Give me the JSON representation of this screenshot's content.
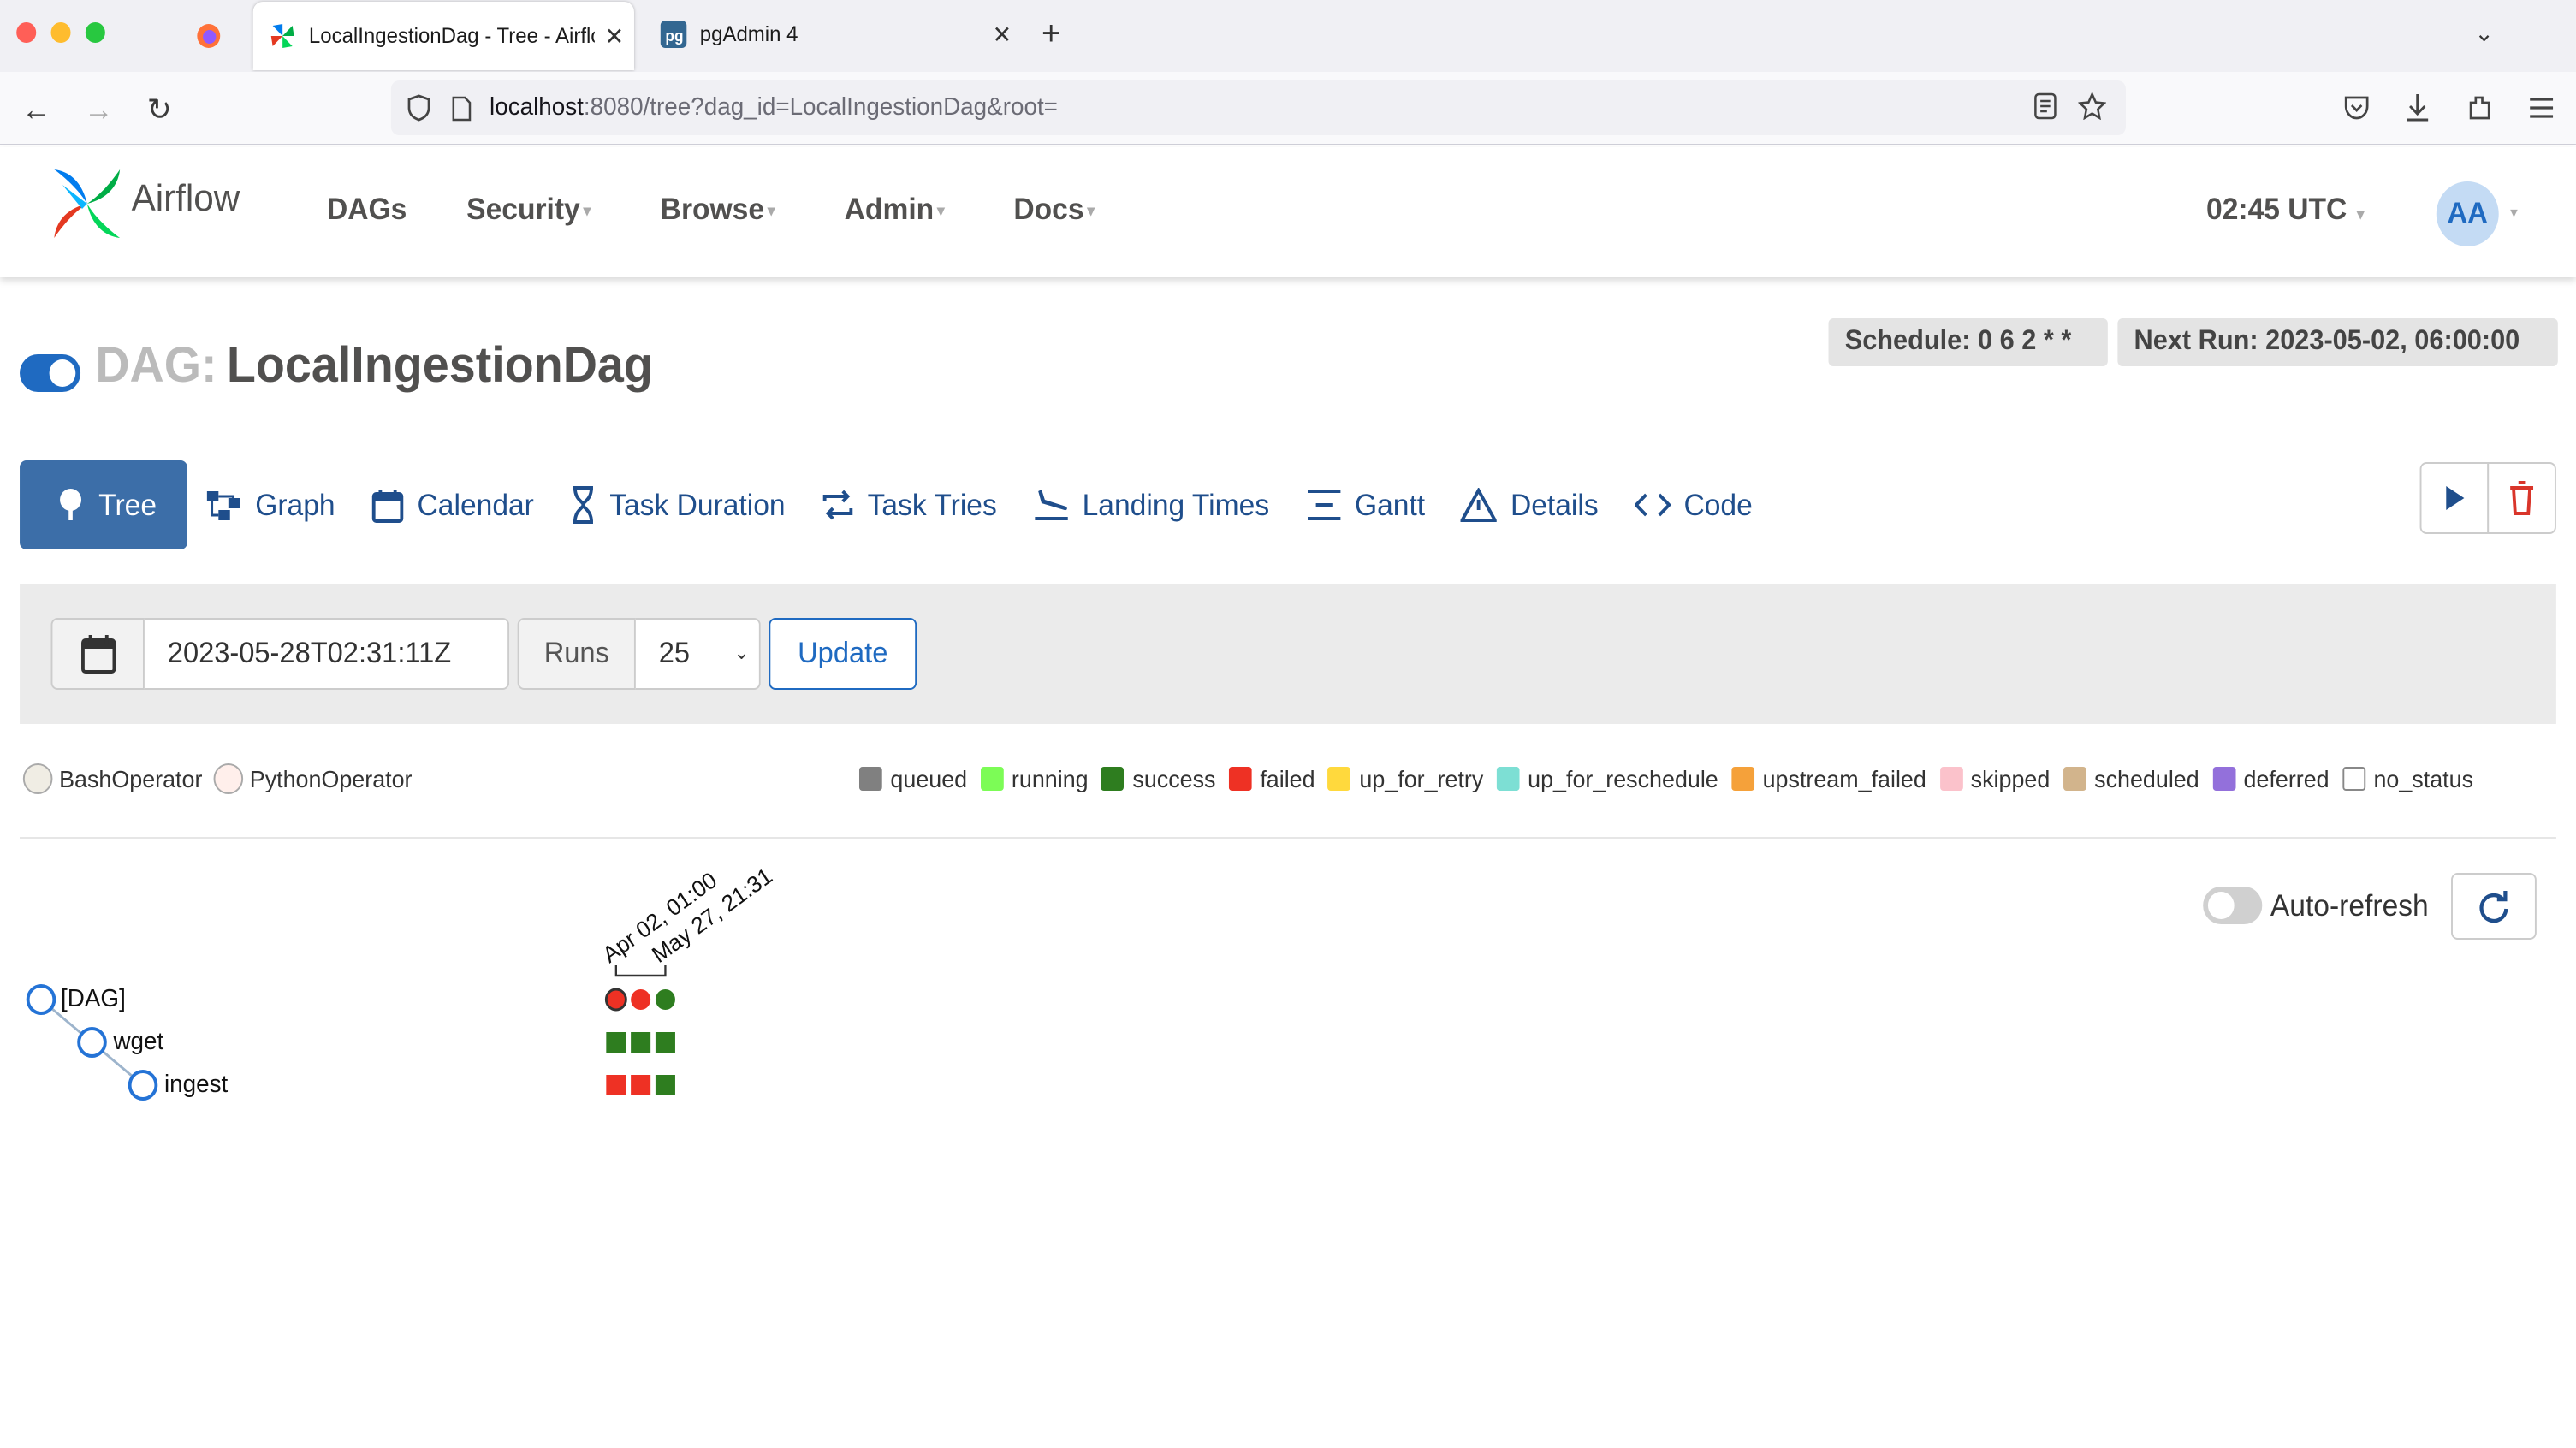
{
  "browser": {
    "tabs": [
      {
        "title": "LocalIngestionDag - Tree - Airflow",
        "active": true,
        "icon": "airflow-pinwheel-icon"
      },
      {
        "title": "pgAdmin 4",
        "active": false,
        "icon": "pgadmin-icon"
      }
    ],
    "url": {
      "host": "localhost",
      "rest": ":8080/tree?dag_id=LocalIngestionDag&root="
    }
  },
  "header": {
    "brand": "Airflow",
    "menu": [
      {
        "label": "DAGs",
        "dropdown": false
      },
      {
        "label": "Security",
        "dropdown": true
      },
      {
        "label": "Browse",
        "dropdown": true
      },
      {
        "label": "Admin",
        "dropdown": true
      },
      {
        "label": "Docs",
        "dropdown": true
      }
    ],
    "clock": "02:45 UTC",
    "avatar": "AA"
  },
  "dag": {
    "prefix": "DAG:",
    "name": "LocalIngestionDag",
    "schedule": "Schedule: 0 6 2 * *",
    "next_run": "Next Run: 2023-05-02, 06:00:00",
    "paused": false
  },
  "views": [
    {
      "label": "Tree",
      "icon": "tree-icon",
      "active": true
    },
    {
      "label": "Graph",
      "icon": "graph-icon"
    },
    {
      "label": "Calendar",
      "icon": "calendar-icon"
    },
    {
      "label": "Task Duration",
      "icon": "hourglass-icon"
    },
    {
      "label": "Task Tries",
      "icon": "retry-icon"
    },
    {
      "label": "Landing Times",
      "icon": "plane-landing-icon"
    },
    {
      "label": "Gantt",
      "icon": "gantt-icon"
    },
    {
      "label": "Details",
      "icon": "warning-triangle-icon"
    },
    {
      "label": "Code",
      "icon": "code-icon"
    }
  ],
  "filter": {
    "base_date": "2023-05-28T02:31:11Z",
    "runs_label": "Runs",
    "runs_value": "25",
    "update_label": "Update"
  },
  "operators": [
    {
      "name": "BashOperator",
      "color": "#f0ede4"
    },
    {
      "name": "PythonOperator",
      "color": "#ffefeb"
    }
  ],
  "states": [
    {
      "name": "queued",
      "color": "#808080"
    },
    {
      "name": "running",
      "color": "#7cfc56"
    },
    {
      "name": "success",
      "color": "#2e7d1f"
    },
    {
      "name": "failed",
      "color": "#ee3124"
    },
    {
      "name": "up_for_retry",
      "color": "#ffd93d"
    },
    {
      "name": "up_for_reschedule",
      "color": "#7ddfd4"
    },
    {
      "name": "upstream_failed",
      "color": "#f5a13a"
    },
    {
      "name": "skipped",
      "color": "#fbc2cb"
    },
    {
      "name": "scheduled",
      "color": "#d2b48c"
    },
    {
      "name": "deferred",
      "color": "#9370db"
    },
    {
      "name": "no_status",
      "color": "#ffffff"
    }
  ],
  "tree": {
    "auto_refresh_label": "Auto-refresh",
    "run_labels": [
      "Apr 02, 01:00",
      "May 27, 21:31"
    ],
    "nodes": [
      "[DAG]",
      "wget",
      "ingest"
    ],
    "dag_runs": [
      "failed",
      "failed",
      "success"
    ],
    "task_instances": {
      "wget": [
        "success",
        "success",
        "success"
      ],
      "ingest": [
        "failed",
        "failed",
        "success"
      ]
    }
  }
}
